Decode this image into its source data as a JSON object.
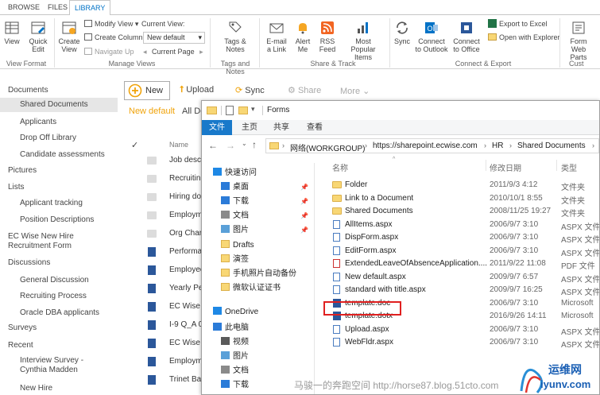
{
  "ribbon_tabs": [
    "BROWSE",
    "FILES",
    "LIBRARY"
  ],
  "ribbon": {
    "view_label": "View",
    "quick_edit_label": "Quick Edit",
    "create_view_label": "Create View",
    "modify_view_label": "Modify View",
    "create_column_label": "Create Column",
    "navigate_up_label": "Navigate Up",
    "current_view_label": "Current View:",
    "current_view_value": "New default",
    "current_page_label": "Current Page",
    "tags_notes_label": "Tags & Notes",
    "email_link_label": "E-mail a Link",
    "alert_me_label": "Alert Me",
    "rss_feed_label": "RSS Feed",
    "most_popular_label": "Most Popular Items",
    "sync_label": "Sync",
    "connect_outlook_label": "Connect to Outlook",
    "connect_office_label": "Connect to Office",
    "export_excel_label": "Export to Excel",
    "open_explorer_label": "Open with Explorer",
    "form_web_parts_label": "Form Web Parts",
    "custom_label": "Cust",
    "groups": {
      "view_format": "View Format",
      "manage_views": "Manage Views",
      "tags_and_notes": "Tags and Notes",
      "share_track": "Share & Track",
      "connect_export": "Connect & Export"
    }
  },
  "leftnav": [
    {
      "label": "Documents",
      "level": 1
    },
    {
      "label": "Shared Documents",
      "level": 2,
      "selected": true
    },
    {
      "label": "Applicants",
      "level": 2
    },
    {
      "label": "Drop Off Library",
      "level": 2
    },
    {
      "label": "Candidate assessments",
      "level": 2
    },
    {
      "label": "Pictures",
      "level": 1
    },
    {
      "label": "Lists",
      "level": 1
    },
    {
      "label": "Applicant tracking",
      "level": 2
    },
    {
      "label": "Position Descriptions",
      "level": 2
    },
    {
      "label": "EC Wise New Hire Recruitment Form",
      "level": 1
    },
    {
      "label": "Discussions",
      "level": 1
    },
    {
      "label": "General Discussion",
      "level": 2
    },
    {
      "label": "Recruiting Process",
      "level": 2
    },
    {
      "label": "Oracle DBA applicants",
      "level": 2
    },
    {
      "label": "Surveys",
      "level": 1
    },
    {
      "label": "Recent",
      "level": 1
    },
    {
      "label": "Interview Survey - Cynthia Madden",
      "level": 2
    },
    {
      "label": "New Hire",
      "level": 2
    }
  ],
  "toolbar": {
    "new_label": "New",
    "upload_label": "Upload",
    "sync_label": "Sync",
    "share_label": "Share",
    "more_label": "More",
    "view_new_default": "New default",
    "view_all": "All Do",
    "name_col": "Name"
  },
  "doc_list": [
    {
      "name": "Job descr",
      "type": "folder"
    },
    {
      "name": "Recruitin",
      "type": "folder"
    },
    {
      "name": "Hiring do",
      "type": "folder"
    },
    {
      "name": "Employm",
      "type": "folder"
    },
    {
      "name": "Org Char",
      "type": "folder"
    },
    {
      "name": "Performa",
      "type": "word"
    },
    {
      "name": "Employee",
      "type": "word"
    },
    {
      "name": "Yearly Pe",
      "type": "word"
    },
    {
      "name": "EC Wise I",
      "type": "word"
    },
    {
      "name": "I-9 Q_A 0",
      "type": "word"
    },
    {
      "name": "EC Wise I",
      "type": "word"
    },
    {
      "name": "Employm",
      "type": "word"
    },
    {
      "name": "Trinet Ba",
      "type": "word"
    }
  ],
  "explorer": {
    "title": "Forms",
    "tabs": [
      "文件",
      "主页",
      "共享",
      "查看"
    ],
    "breadcrumb": [
      "网络(WORKGROUP)",
      "https://sharepoint.ecwise.com",
      "HR",
      "Shared Documents"
    ],
    "columns": {
      "name": "名称",
      "date": "修改日期",
      "type": "类型"
    },
    "nav": [
      {
        "label": "快速访问",
        "icon": "star-icon",
        "indent": 0,
        "pinned": false
      },
      {
        "label": "桌面",
        "icon": "desktop-icon",
        "indent": 1,
        "pinned": true
      },
      {
        "label": "下载",
        "icon": "download-icon",
        "indent": 1,
        "pinned": true
      },
      {
        "label": "文档",
        "icon": "document-icon",
        "indent": 1,
        "pinned": true
      },
      {
        "label": "图片",
        "icon": "picture-icon",
        "indent": 1,
        "pinned": true
      },
      {
        "label": "Drafts",
        "icon": "folder-icon",
        "indent": 1,
        "pinned": false
      },
      {
        "label": "演签",
        "icon": "folder-icon",
        "indent": 1,
        "pinned": false
      },
      {
        "label": "手机照片自动备份",
        "icon": "folder-icon",
        "indent": 1,
        "pinned": false
      },
      {
        "label": "微软认证证书",
        "icon": "folder-icon",
        "indent": 1,
        "pinned": false
      },
      {
        "label": "OneDrive",
        "icon": "cloud-icon",
        "indent": 0,
        "pinned": false
      },
      {
        "label": "此电脑",
        "icon": "computer-icon",
        "indent": 0,
        "pinned": false
      },
      {
        "label": "视频",
        "icon": "video-icon",
        "indent": 1,
        "pinned": false
      },
      {
        "label": "图片",
        "icon": "picture-icon",
        "indent": 1,
        "pinned": false
      },
      {
        "label": "文档",
        "icon": "document-icon",
        "indent": 1,
        "pinned": false
      },
      {
        "label": "下载",
        "icon": "download-icon",
        "indent": 1,
        "pinned": false
      }
    ],
    "files": [
      {
        "name": "Folder",
        "date": "2011/9/3 4:12",
        "type": "文件夹",
        "icon": "folder"
      },
      {
        "name": "Link to a Document",
        "date": "2010/10/1 8:55",
        "type": "文件夹",
        "icon": "folder"
      },
      {
        "name": "Shared Documents",
        "date": "2008/11/25 19:27",
        "type": "文件夹",
        "icon": "folder"
      },
      {
        "name": "AllItems.aspx",
        "date": "2006/9/7 3:10",
        "type": "ASPX 文件",
        "icon": "file"
      },
      {
        "name": "DispForm.aspx",
        "date": "2006/9/7 3:10",
        "type": "ASPX 文件",
        "icon": "file"
      },
      {
        "name": "EditForm.aspx",
        "date": "2006/9/7 3:10",
        "type": "ASPX 文件",
        "icon": "file"
      },
      {
        "name": "ExtendedLeaveOfAbsenceApplication....",
        "date": "2011/9/22 11:08",
        "type": "PDF 文件",
        "icon": "pdf"
      },
      {
        "name": "New default.aspx",
        "date": "2009/9/7 6:57",
        "type": "ASPX 文件",
        "icon": "file"
      },
      {
        "name": "standard with title.aspx",
        "date": "2009/9/7 16:25",
        "type": "ASPX 文件",
        "icon": "file"
      },
      {
        "name": "template.doc",
        "date": "2006/9/7 3:10",
        "type": "Microsoft",
        "icon": "word"
      },
      {
        "name": "template.dotx",
        "date": "2016/9/26 14:11",
        "type": "Microsoft",
        "icon": "word"
      },
      {
        "name": "Upload.aspx",
        "date": "2006/9/7 3:10",
        "type": "ASPX 文件",
        "icon": "file"
      },
      {
        "name": "WebFldr.aspx",
        "date": "2006/9/7 3:10",
        "type": "ASPX 文件",
        "icon": "file"
      }
    ]
  },
  "watermark": {
    "text": "马骏一的奔跑空间 http://horse87.blog.51cto.com",
    "logo_text_1": "运维网",
    "logo_text_2": "iyunv.com"
  }
}
